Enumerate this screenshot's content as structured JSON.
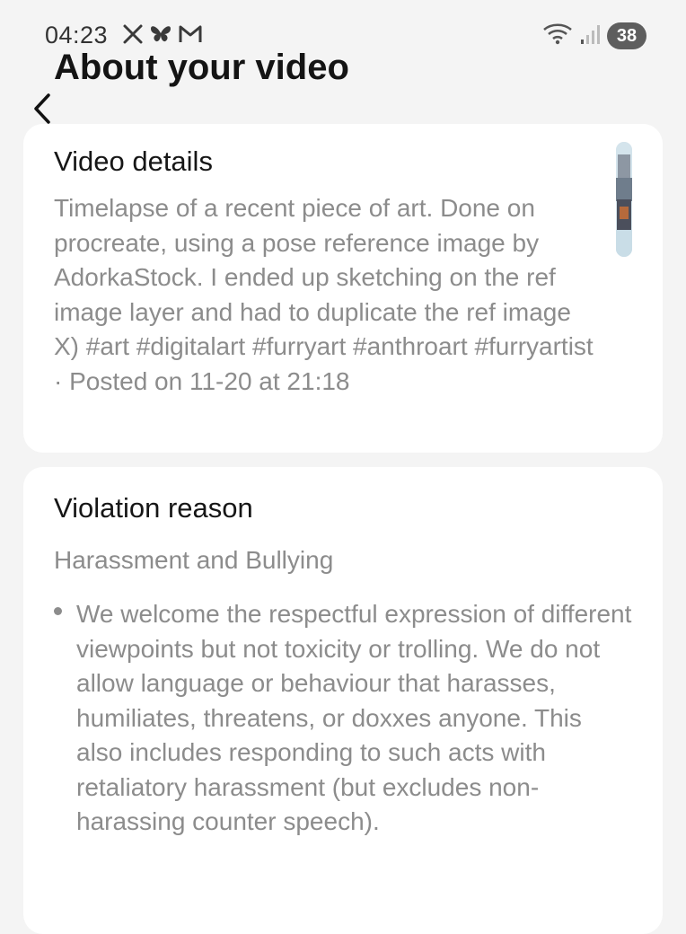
{
  "status_bar": {
    "time": "04:23",
    "notification_icons": [
      "x-icon",
      "butterfly-icon",
      "mail-icon"
    ],
    "battery": "38"
  },
  "header": {
    "title": "About your video"
  },
  "video_details": {
    "title": "Video details",
    "description": "Timelapse of a recent piece of art. Done on procreate, using a pose reference image by AdorkaStock. I ended up sketching on the ref image layer and had to duplicate the ref image X) #art #digitalart #furryart #anthroart #furryartist",
    "posted": "· Posted on 11-20 at 21:18"
  },
  "violation": {
    "title": "Violation reason",
    "reason": "Harassment and Bullying",
    "bullet": "We welcome the respectful expression of different viewpoints but not toxicity or trolling. We do not allow language or behaviour that harasses, humiliates, threatens, or doxxes anyone. This also includes responding to such acts with retaliatory harassment (but excludes non-harassing counter speech)."
  }
}
